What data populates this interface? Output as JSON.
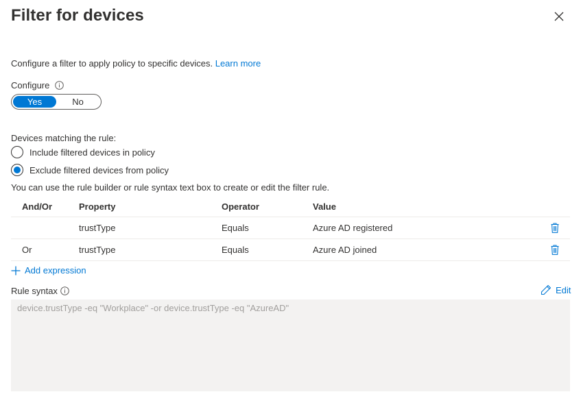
{
  "panel": {
    "title": "Filter for devices",
    "intro_text": "Configure a filter to apply policy to specific devices.",
    "learn_more": "Learn more"
  },
  "configure": {
    "label": "Configure",
    "options": [
      "Yes",
      "No"
    ],
    "selected": "Yes"
  },
  "matching": {
    "label": "Devices matching the rule:",
    "options": [
      {
        "label": "Include filtered devices in policy",
        "selected": false
      },
      {
        "label": "Exclude filtered devices from policy",
        "selected": true
      }
    ]
  },
  "help_text": "You can use the rule builder or rule syntax text box to create or edit the filter rule.",
  "table": {
    "headers": [
      "And/Or",
      "Property",
      "Operator",
      "Value"
    ],
    "rows": [
      {
        "andor": "",
        "property": "trustType",
        "operator": "Equals",
        "value": "Azure AD registered"
      },
      {
        "andor": "Or",
        "property": "trustType",
        "operator": "Equals",
        "value": "Azure AD joined"
      }
    ]
  },
  "add_expression": "Add expression",
  "rule_syntax": {
    "label": "Rule syntax",
    "edit_label": "Edit",
    "value": "device.trustType -eq \"Workplace\" -or device.trustType -eq \"AzureAD\""
  },
  "colors": {
    "accent": "#0078d4",
    "text": "#323130",
    "syntax_bg": "#f3f2f1"
  },
  "icons": [
    "close-icon",
    "info-icon",
    "trash-icon",
    "plus-icon",
    "pencil-icon"
  ]
}
